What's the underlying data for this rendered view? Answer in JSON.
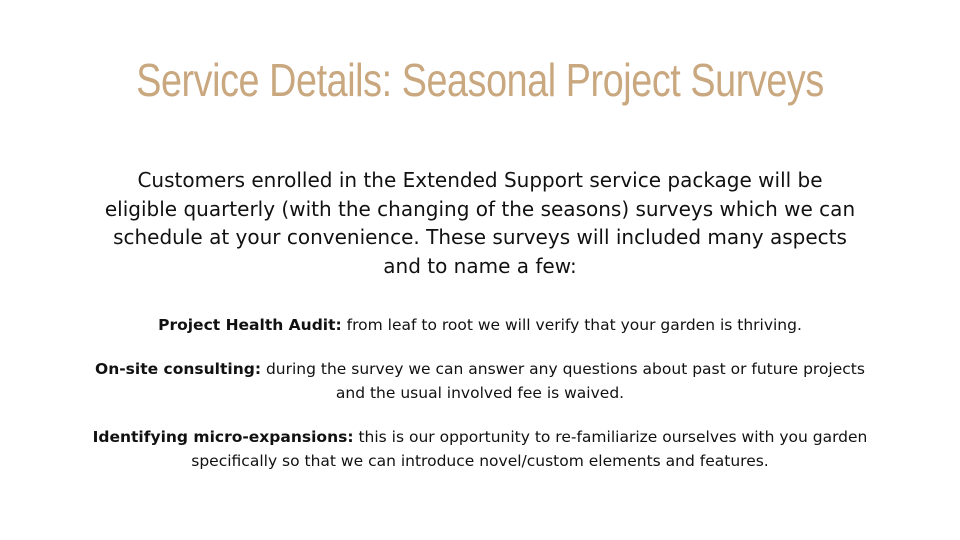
{
  "slide": {
    "title": "Service Details: Seasonal Project Surveys",
    "intro": "Customers enrolled in the Extended Support service package will be eligible quarterly (with the changing of the seasons) surveys which we can schedule at your convenience.  These surveys will included many aspects and to name a few:",
    "items": [
      {
        "label": "Project Health Audit:",
        "text": " from leaf to root we will verify that your garden is thriving."
      },
      {
        "label": "On-site consulting:",
        "text": " during the survey we can answer any questions about past or future projects and the usual involved fee is waived."
      },
      {
        "label": "Identifying micro-expansions:",
        "text": " this is our opportunity to re-familiarize ourselves with you garden specifically so that we can introduce novel/custom elements and features."
      }
    ]
  },
  "colors": {
    "title": "#c9a77f",
    "text": "#111111",
    "background": "#ffffff"
  }
}
